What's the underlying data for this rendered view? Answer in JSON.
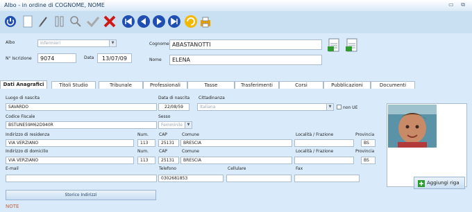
{
  "window": {
    "title": "Albo - in ordine di COGNOME, NOME",
    "controls": "▭ ⧉"
  },
  "toolbar": {
    "icons": [
      "power-icon",
      "new-icon",
      "edit-icon",
      "columns-icon",
      "search-icon",
      "confirm-icon",
      "delete-icon",
      "first-icon",
      "prev-icon",
      "next-icon",
      "last-icon",
      "refresh-icon",
      "print-icon"
    ]
  },
  "header": {
    "albo_label": "Albo",
    "albo_value": "Infermieri",
    "iscrizione_label": "N° Iscrizione",
    "iscrizione_value": "9074",
    "data_label": "Data",
    "data_value": "13/07/09",
    "cognome_label": "Cognome",
    "cognome_value": "ABASTANOTTI",
    "nome_label": "Nome",
    "nome_value": "ELENA"
  },
  "tabs": [
    "Dati Anagrafici",
    "Titoli Studio",
    "Tribunale",
    "Professionali",
    "Tasse",
    "Trasferimenti",
    "Corsi",
    "Pubblicazioni",
    "Documenti"
  ],
  "anagrafica": {
    "luogo_label": "Luogo di nascita",
    "luogo_value": "SAVARDO",
    "data_nascita_label": "Data di nascita",
    "data_nascita_value": "22/08/59",
    "cittadinanza_label": "Cittadinanza",
    "cittadinanza_value": "Italiana",
    "non_ue_label": "non UE",
    "cf_label": "Codice Fiscale",
    "cf_value": "BSTUNE59M62D940R",
    "sesso_label": "Sesso",
    "sesso_value": "Femminile",
    "residenza_label": "Indirizzo di residenza",
    "residenza_value": "VIA VERZIANO",
    "num_label": "Num.",
    "res_num": "113",
    "cap_label": "CAP",
    "res_cap": "25131",
    "comune_label": "Comune",
    "res_comune": "BRESCIA",
    "localita_label": "Località / Frazione",
    "provincia_label": "Provincia",
    "res_prov": "BS",
    "domicilio_label": "Indirizzo di domicilio",
    "domicilio_value": "VIA VERZIANO",
    "dom_num": "113",
    "dom_cap": "25131",
    "dom_comune": "BRESCIA",
    "dom_prov": "BS",
    "email_label": "E-mail",
    "telefono_label": "Telefono",
    "telefono_value": "0302681853",
    "cellulare_label": "Cellulare",
    "fax_label": "Fax",
    "storico_button": "Storico Indirizzi",
    "note_label": "NOTE",
    "aggiungi_button": "Aggiungi riga"
  }
}
